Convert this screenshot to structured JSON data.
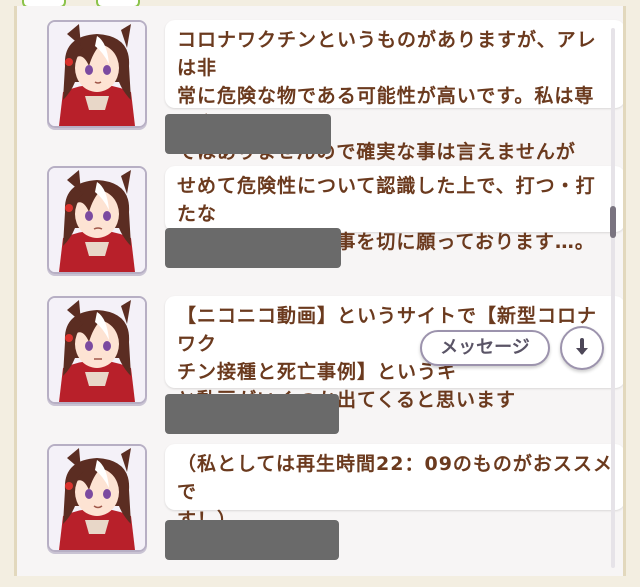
{
  "messages": [
    {
      "text": "コロナワクチンというものがありますが、アレは非\n常に危険な物である可能性が高いです。私は専門家\nではありませんので確実な事は言えませんが"
    },
    {
      "text": "せめて危険性について認識した上で、打つ・打たな\nいを選択して頂く事を切に願っております…。"
    },
    {
      "text": "【ニコニコ動画】というサイトで【新型コロナワク\nチン接種と死亡事例】というキ\nと動画がいくつか出てくると思います"
    },
    {
      "text": "（私としては再生時間22：09のものがおススメで\nす！）"
    }
  ],
  "controls": {
    "message_button_label": "メッセージ",
    "scroll_down_icon": "arrow-down-icon"
  },
  "colors": {
    "text_brown": "#6b3a1e",
    "redaction_gray": "#6a6a6a",
    "button_border": "#9c93ad"
  }
}
